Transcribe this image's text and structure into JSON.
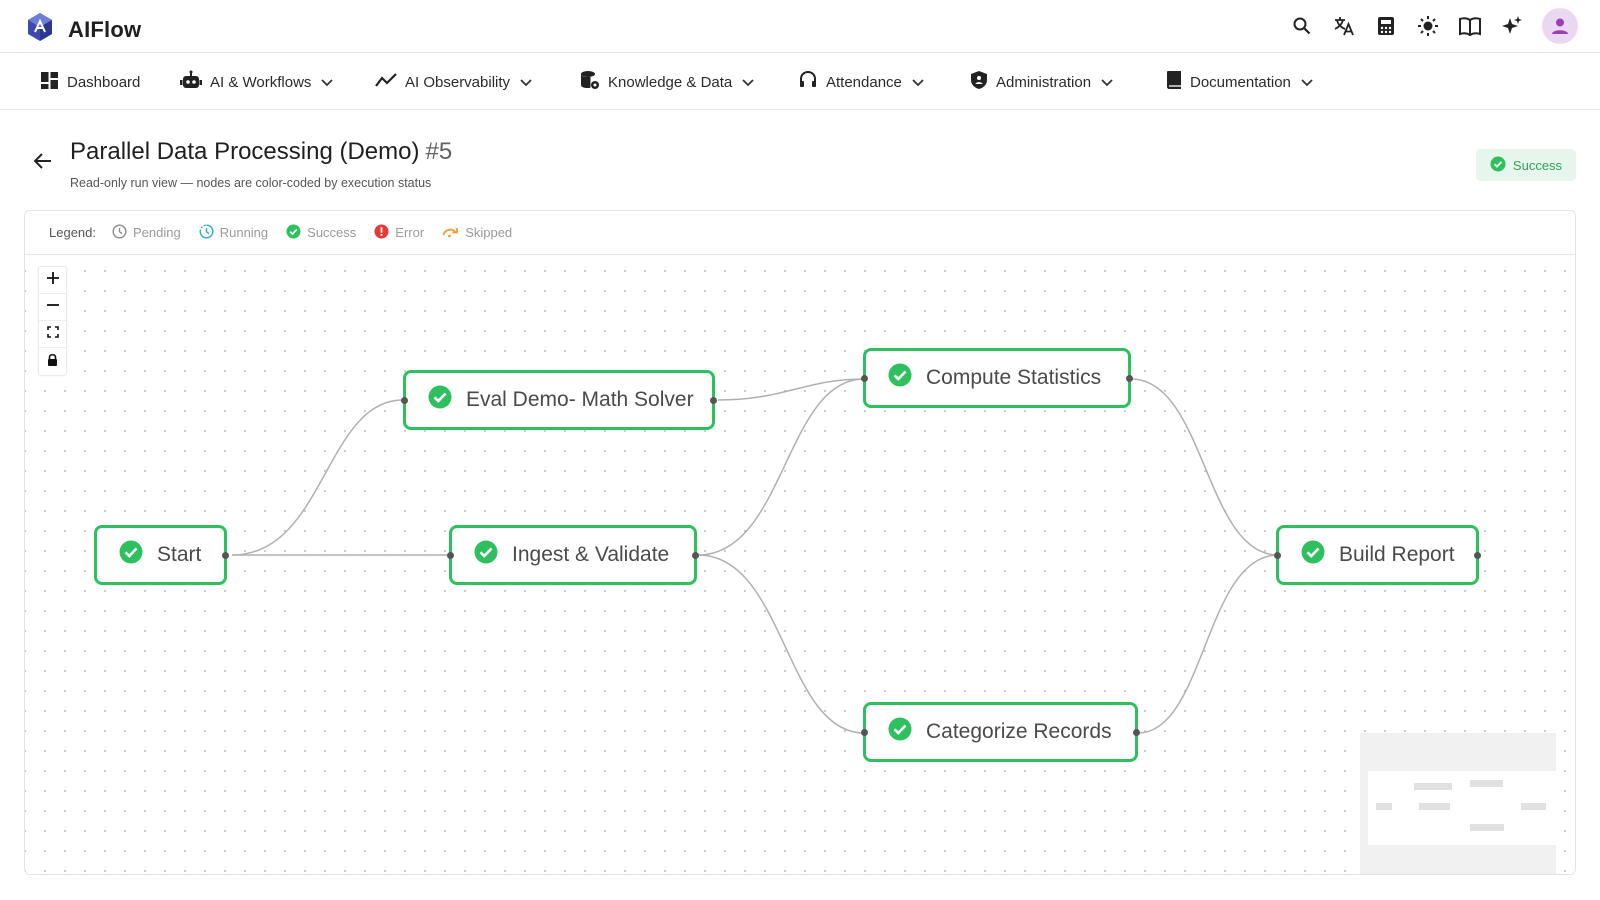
{
  "app": {
    "name": "AIFlow"
  },
  "top_icons": [
    "search-icon",
    "translate-icon",
    "calculator-icon",
    "sun-icon",
    "book-icon",
    "sparkle-icon",
    "user-avatar-icon"
  ],
  "nav": {
    "items": [
      {
        "label": "Dashboard",
        "icon": "dashboard-icon",
        "dropdown": false
      },
      {
        "label": "AI & Workflows",
        "icon": "robot-icon",
        "dropdown": true
      },
      {
        "label": "AI Observability",
        "icon": "trend-icon",
        "dropdown": true
      },
      {
        "label": "Knowledge & Data",
        "icon": "database-icon",
        "dropdown": true
      },
      {
        "label": "Attendance",
        "icon": "headset-icon",
        "dropdown": true
      },
      {
        "label": "Administration",
        "icon": "shield-icon",
        "dropdown": true
      },
      {
        "label": "Documentation",
        "icon": "book-icon",
        "dropdown": true
      }
    ]
  },
  "header": {
    "title": "Parallel Data Processing (Demo)",
    "run_number": "#5",
    "subtitle": "Read-only run view — nodes are color-coded by execution status",
    "status": "Success"
  },
  "legend": {
    "title": "Legend:",
    "items": [
      {
        "label": "Pending",
        "icon": "clock-icon",
        "color": "#9e9e9e"
      },
      {
        "label": "Running",
        "icon": "running-clock-icon",
        "color": "#29a9d8"
      },
      {
        "label": "Success",
        "icon": "check-circle-icon",
        "color": "#2ec05e"
      },
      {
        "label": "Error",
        "icon": "error-icon",
        "color": "#e53935"
      },
      {
        "label": "Skipped",
        "icon": "skip-icon",
        "color": "#f29b38"
      }
    ]
  },
  "canvas_controls": [
    "zoom-in",
    "zoom-out",
    "fit-view",
    "lock"
  ],
  "graph": {
    "nodes": [
      {
        "id": "start",
        "label": "Start",
        "status": "success"
      },
      {
        "id": "eval",
        "label": "Eval Demo- Math Solver",
        "status": "success"
      },
      {
        "id": "ingest",
        "label": "Ingest & Validate",
        "status": "success"
      },
      {
        "id": "compute",
        "label": "Compute Statistics",
        "status": "success"
      },
      {
        "id": "categorize",
        "label": "Categorize Records",
        "status": "success"
      },
      {
        "id": "report",
        "label": "Build Report",
        "status": "success"
      }
    ],
    "edges": [
      [
        "start",
        "eval"
      ],
      [
        "start",
        "ingest"
      ],
      [
        "eval",
        "compute"
      ],
      [
        "ingest",
        "compute"
      ],
      [
        "ingest",
        "categorize"
      ],
      [
        "compute",
        "report"
      ],
      [
        "categorize",
        "report"
      ]
    ]
  },
  "colors": {
    "success": "#2ec05e",
    "edge": "#b0b0b0",
    "brand": "#3949ab"
  }
}
